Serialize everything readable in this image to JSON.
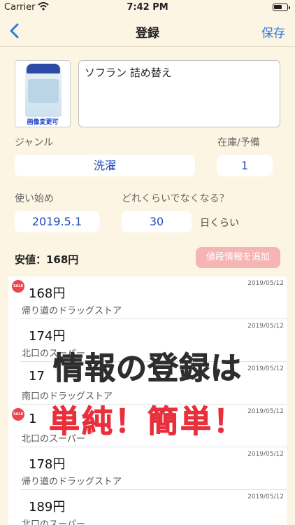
{
  "status_bar": {
    "carrier": "Carrier",
    "time": "7:42 PM"
  },
  "nav": {
    "title": "登録",
    "save_label": "保存"
  },
  "item": {
    "image_caption": "画像変更可",
    "name": "ソフラン 詰め替え"
  },
  "fields": {
    "genre_label": "ジャンル",
    "genre_value": "洗濯",
    "stock_label": "在庫/予備",
    "stock_value": "1",
    "start_label": "使い始め",
    "start_value": "2019.5.1",
    "duration_label": "どれくらいでなくなる？",
    "duration_value": "30",
    "duration_unit": "日くらい"
  },
  "price_summary": {
    "cheapest": "安値：168円",
    "add_button": "値段情報を追加"
  },
  "price_list": [
    {
      "price": "168円",
      "shop": "帰り道のドラッグストア",
      "date": "2019/05/12",
      "sale": true
    },
    {
      "price": "174円",
      "shop": "北口のスーパー",
      "date": "2019/05/12",
      "sale": false
    },
    {
      "price": "17",
      "shop": "南口のドラッグストア",
      "date": "2019/05/12",
      "sale": false
    },
    {
      "price": "1",
      "shop": "北口のスーパー",
      "date": "2019/05/12",
      "sale": true
    },
    {
      "price": "178円",
      "shop": "帰り道のドラッグストア",
      "date": "2019/05/12",
      "sale": false
    },
    {
      "price": "189円",
      "shop": "北口のスーパー",
      "date": "2019/05/12",
      "sale": false
    }
  ],
  "sale_badge": "SALE",
  "overlay": {
    "line1": "情報の登録は",
    "line2": "単純！簡単！"
  },
  "colors": {
    "background": "#fdf5e3",
    "accent": "#2a7ae2",
    "field_text": "#1f49b8",
    "add_button": "#f7b4b4",
    "overlay_red": "#e8303c"
  }
}
